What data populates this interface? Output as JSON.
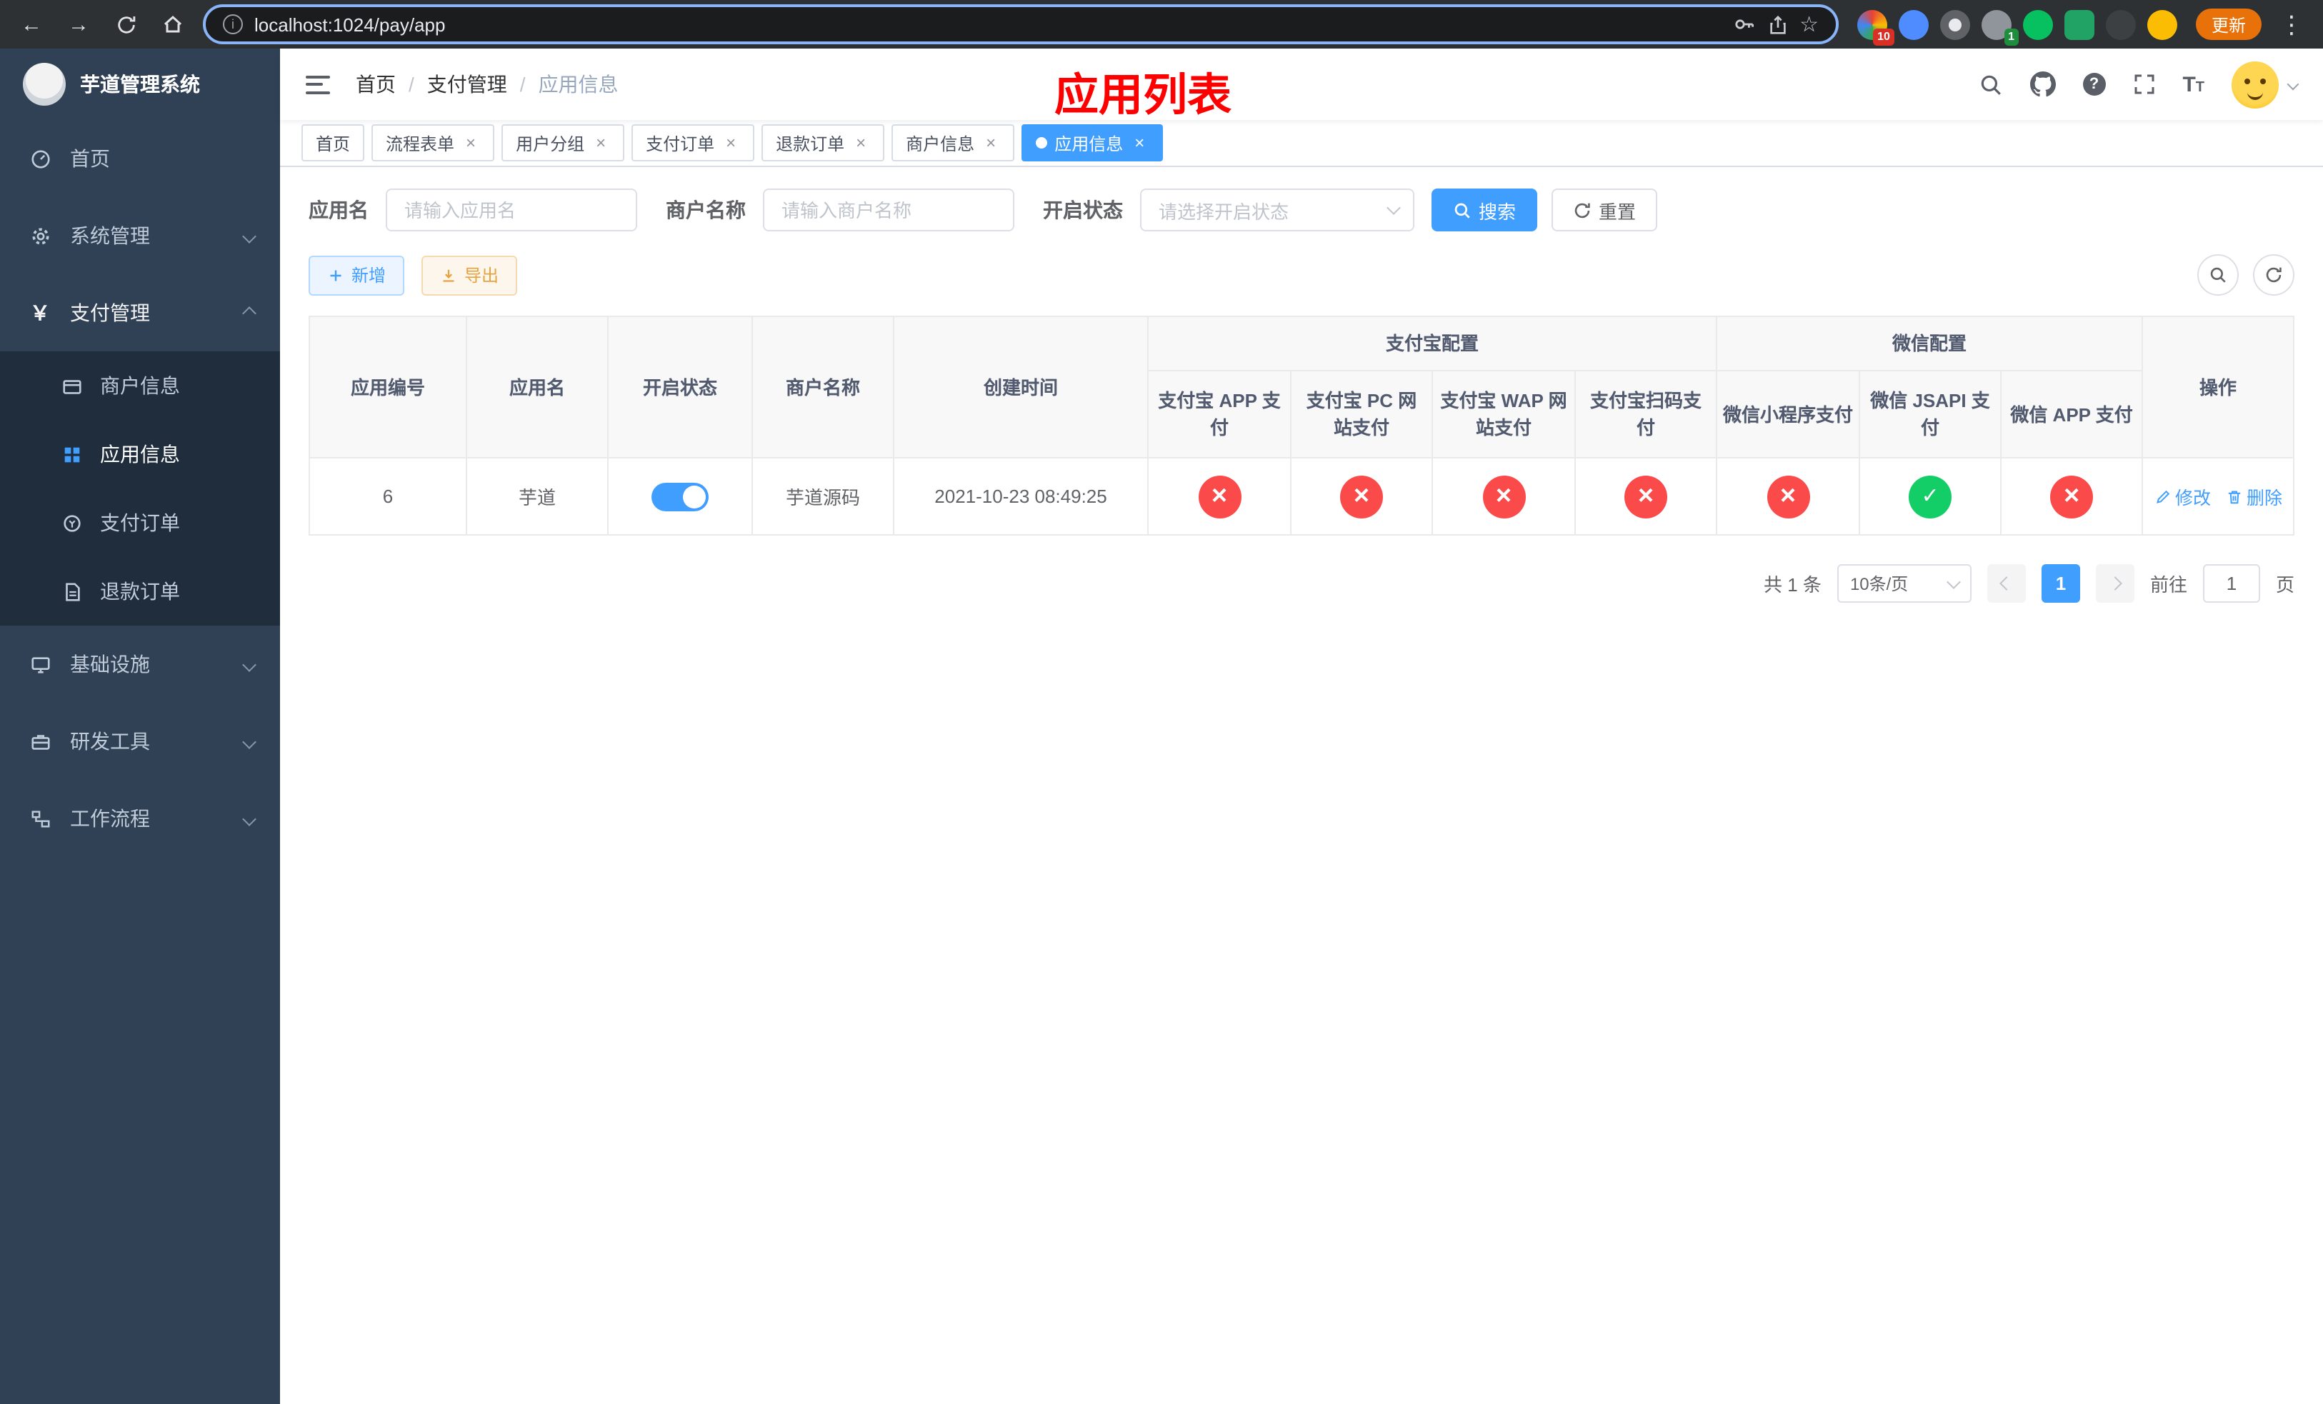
{
  "browser": {
    "url": "localhost:1024/pay/app",
    "update_button": "更新",
    "extension_badge_red": "10",
    "extension_badge_green": "1"
  },
  "sidebar": {
    "title": "芋道管理系统",
    "items": [
      {
        "label": "首页"
      },
      {
        "label": "系统管理"
      },
      {
        "label": "支付管理",
        "children": [
          {
            "label": "商户信息"
          },
          {
            "label": "应用信息"
          },
          {
            "label": "支付订单"
          },
          {
            "label": "退款订单"
          }
        ]
      },
      {
        "label": "基础设施"
      },
      {
        "label": "研发工具"
      },
      {
        "label": "工作流程"
      }
    ]
  },
  "header": {
    "breadcrumb": [
      "首页",
      "支付管理",
      "应用信息"
    ],
    "breadcrumb_separator": "/",
    "page_title": "应用列表"
  },
  "tabs": [
    {
      "label": "首页"
    },
    {
      "label": "流程表单"
    },
    {
      "label": "用户分组"
    },
    {
      "label": "支付订单"
    },
    {
      "label": "退款订单"
    },
    {
      "label": "商户信息"
    },
    {
      "label": "应用信息"
    }
  ],
  "filters": {
    "app_name_label": "应用名",
    "app_name_placeholder": "请输入应用名",
    "merchant_label": "商户名称",
    "merchant_placeholder": "请输入商户名称",
    "status_label": "开启状态",
    "status_placeholder": "请选择开启状态",
    "search_button": "搜索",
    "reset_button": "重置"
  },
  "toolbar": {
    "add_button": "新增",
    "export_button": "导出"
  },
  "table": {
    "columns_simple": [
      "应用编号",
      "应用名",
      "开启状态",
      "商户名称",
      "创建时间"
    ],
    "group_alipay": {
      "label": "支付宝配置",
      "columns": [
        "支付宝 APP 支付",
        "支付宝 PC 网站支付",
        "支付宝 WAP 网站支付",
        "支付宝扫码支付"
      ]
    },
    "group_wechat": {
      "label": "微信配置",
      "columns": [
        "微信小程序支付",
        "微信 JSAPI 支付",
        "微信 APP 支付"
      ]
    },
    "ops_column": "操作",
    "rows": [
      {
        "id": "6",
        "name": "芋道",
        "status_on": true,
        "merchant": "芋道源码",
        "created": "2021-10-23 08:49:25",
        "configs": [
          "fail",
          "fail",
          "fail",
          "fail",
          "fail",
          "ok",
          "fail"
        ],
        "edit_label": "修改",
        "delete_label": "删除"
      }
    ]
  },
  "pagination": {
    "total": "共 1 条",
    "page_size": "10条/页",
    "current_page": "1",
    "goto_label": "前往",
    "goto_value": "1",
    "goto_unit": "页"
  },
  "colors": {
    "accent_blue": "#409eff",
    "danger_red": "#fa4b4a",
    "success_green": "#13ce66",
    "warning_orange": "#e6a23c",
    "sidebar_bg": "#304156",
    "submenu_bg": "#1f2d3d",
    "title_red": "#ff0000",
    "update_orange": "#e8710a"
  }
}
